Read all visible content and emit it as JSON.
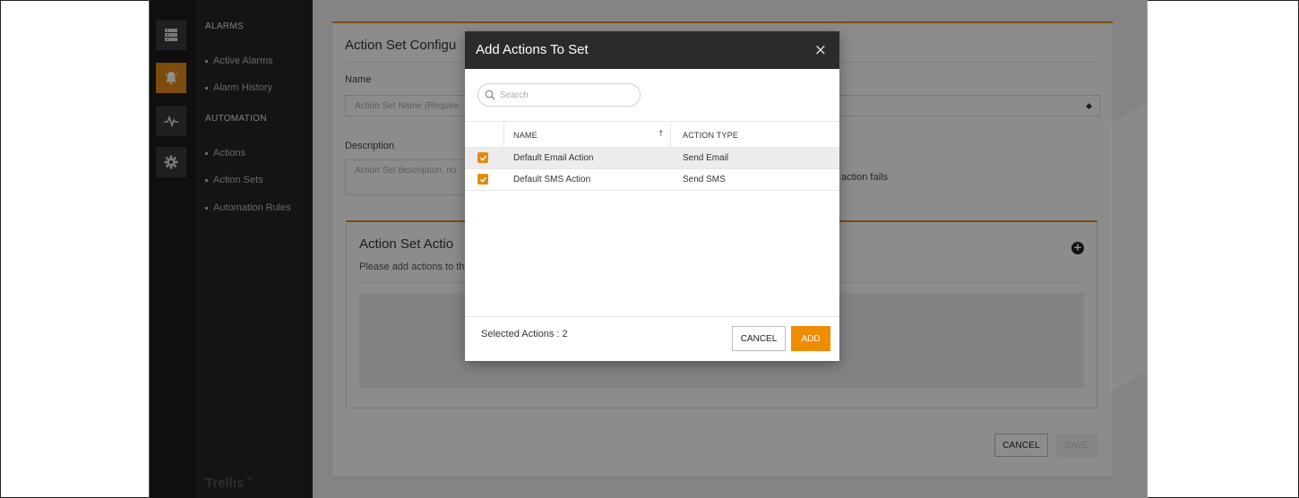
{
  "brand": {
    "name": "Trellis",
    "mark": "™"
  },
  "nav": {
    "alarms_heading": "ALARMS",
    "alarms_items": [
      "Active Alarms",
      "Alarm History"
    ],
    "automation_heading": "AUTOMATION",
    "automation_items": [
      "Actions",
      "Action Sets",
      "Automation Rules"
    ]
  },
  "rail": {
    "icons": [
      "server-icon",
      "alarm-bell-icon",
      "pulse-icon",
      "gear-icon"
    ],
    "active": "alarm-bell-icon"
  },
  "form": {
    "title": "Action Set Configu",
    "name_label": "Name",
    "name_placeholder": "Action Set Name (Require",
    "description_label": "Description",
    "description_placeholder": "Action Set description, no",
    "fails_text": "action fails"
  },
  "actions_panel": {
    "title": "Action Set Actio",
    "subtitle": "Please add actions to th"
  },
  "page_footer": {
    "cancel": "CANCEL",
    "save": "SAVE"
  },
  "modal": {
    "title": "Add Actions To Set",
    "close": "×",
    "search_placeholder": "Search",
    "columns": {
      "name": "NAME",
      "action_type": "ACTION TYPE"
    },
    "rows": [
      {
        "name": "Default Email Action",
        "action_type": "Send Email",
        "checked": true
      },
      {
        "name": "Default SMS Action",
        "action_type": "Send SMS",
        "checked": true
      }
    ],
    "selected_label": "Selected Actions : 2",
    "cancel": "CANCEL",
    "add": "ADD"
  },
  "colors": {
    "accent": "#e18b16",
    "add_button": "#f08c00",
    "sidebar": "#262626",
    "modal_header": "#2b2b2b"
  }
}
